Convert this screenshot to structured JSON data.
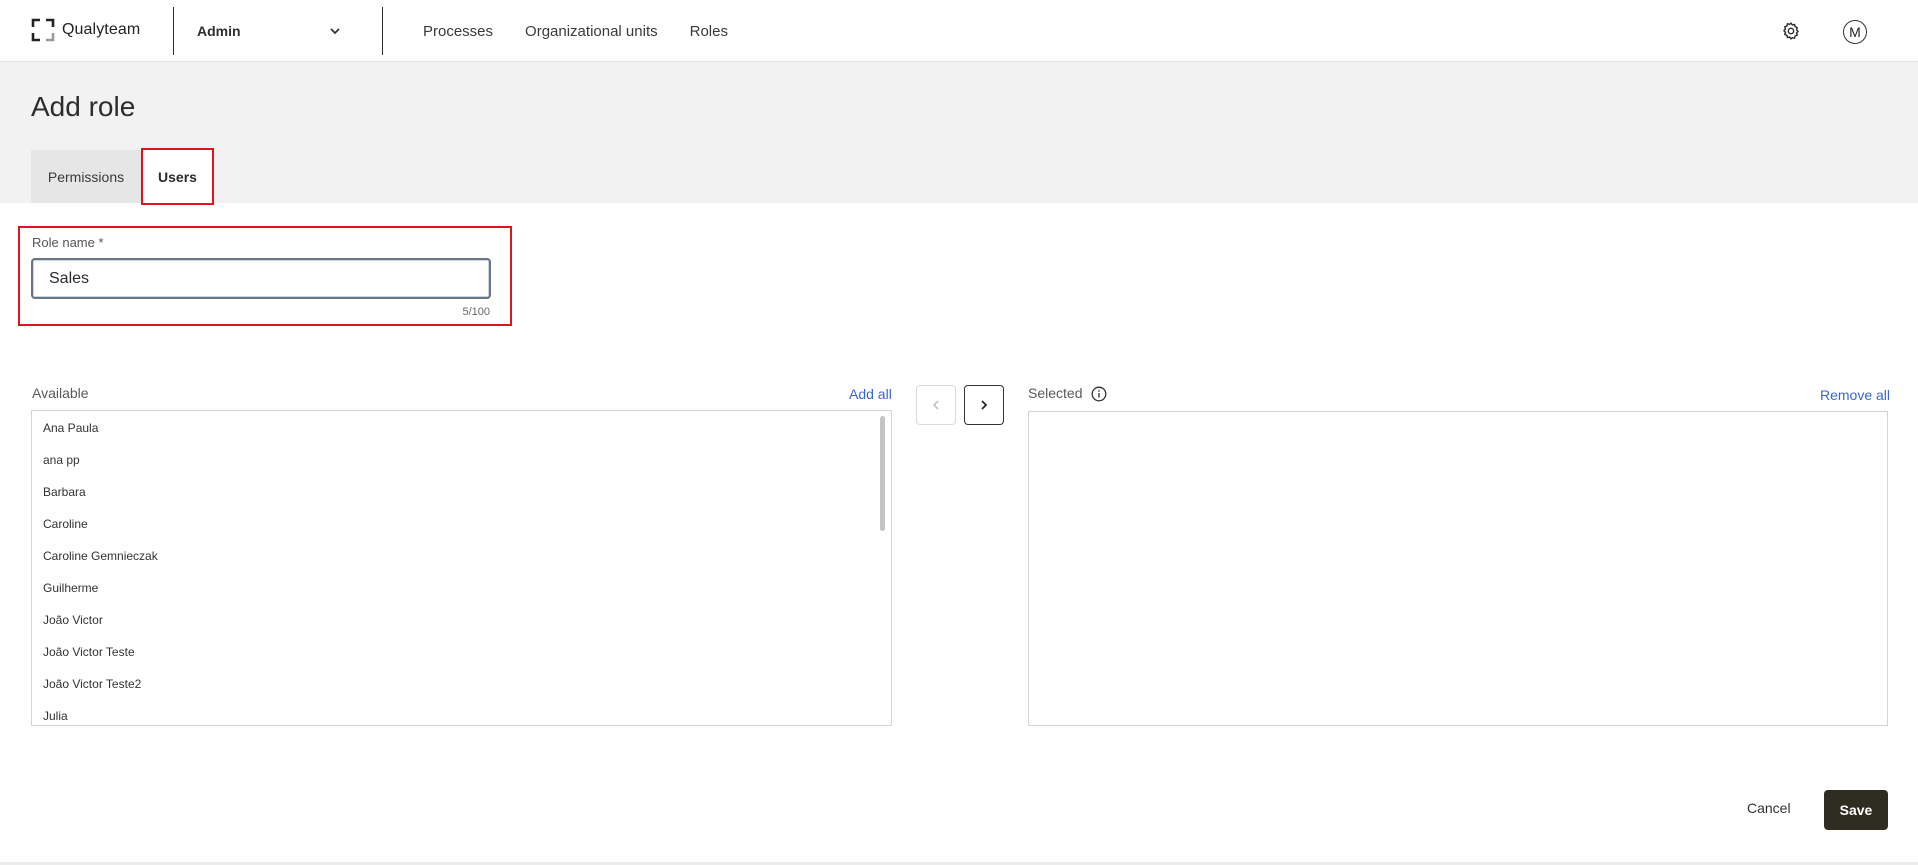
{
  "app": {
    "logo_text": "Qualyteam",
    "module": "Admin"
  },
  "nav": {
    "items": [
      "Processes",
      "Organizational units",
      "Roles"
    ]
  },
  "user": {
    "avatar_initial": "M"
  },
  "page": {
    "title": "Add role",
    "tabs": [
      {
        "label": "Permissions",
        "active": false
      },
      {
        "label": "Users",
        "active": true
      }
    ]
  },
  "form": {
    "role_name_label": "Role name *",
    "role_name_value": "Sales",
    "char_counter": "5/100"
  },
  "available": {
    "label": "Available",
    "add_all_label": "Add all",
    "items": [
      "Ana Paula",
      "ana pp",
      "Barbara",
      "Caroline",
      "Caroline Gemnieczak",
      "Guilherme",
      "João Victor",
      "João Victor Teste",
      "João Victor Teste2",
      "Julia"
    ]
  },
  "selected": {
    "label": "Selected",
    "remove_all_label": "Remove all",
    "items": []
  },
  "actions": {
    "cancel_label": "Cancel",
    "save_label": "Save"
  },
  "colors": {
    "highlight": "#e0141e",
    "link": "#3b67c9",
    "save_button": "#2e2d1f",
    "header_band": "#f2f2f2"
  }
}
